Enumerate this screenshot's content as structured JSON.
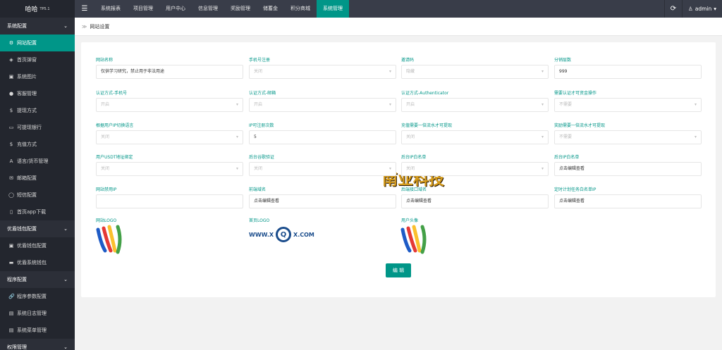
{
  "topbar": {
    "brand": "哈哈",
    "brand_sup": "TP5.1",
    "menu_icon": "☰",
    "nav": [
      "系统报表",
      "项目管理",
      "用户中心",
      "信息管理",
      "奖励管理",
      "储蓄金",
      "积分商城",
      "系统管理"
    ],
    "active_index": 7,
    "user": "admin",
    "user_caret": "▾"
  },
  "sidebar": {
    "groups": [
      {
        "label": "系统配置",
        "items": [
          {
            "icon": "⚙",
            "label": "网站配置",
            "active": true
          },
          {
            "icon": "◈",
            "label": "首页弹窗"
          },
          {
            "icon": "▣",
            "label": "系统图片"
          },
          {
            "icon": "●",
            "label": "客服管理"
          },
          {
            "icon": "$",
            "label": "提现方式"
          },
          {
            "icon": "▭",
            "label": "可提现银行"
          },
          {
            "icon": "$",
            "label": "充值方式"
          },
          {
            "icon": "A",
            "label": "语言/货币管理"
          },
          {
            "icon": "✉",
            "label": "邮箱配置"
          },
          {
            "icon": "◯",
            "label": "短信配置"
          },
          {
            "icon": "▯",
            "label": "首页app下载"
          }
        ]
      },
      {
        "label": "优盾钱包配置",
        "items": [
          {
            "icon": "▣",
            "label": "优盾钱包配置"
          },
          {
            "icon": "▬",
            "label": "优盾系统钱包"
          }
        ]
      },
      {
        "label": "程序配置",
        "items": [
          {
            "icon": "🔗",
            "label": "程序参数配置"
          },
          {
            "icon": "▤",
            "label": "系统日志管理"
          },
          {
            "icon": "▤",
            "label": "系统菜单管理"
          }
        ]
      },
      {
        "label": "权限管理",
        "items": []
      }
    ]
  },
  "breadcrumb": {
    "sep": "≫",
    "label": "网站设置"
  },
  "form": {
    "rows": [
      [
        {
          "label": "网站名称",
          "value": "仅供学习研究，禁止用于非法用途",
          "type": "text"
        },
        {
          "label": "手机号注册",
          "value": "关闭",
          "type": "select"
        },
        {
          "label": "邀请码",
          "value": "隐藏",
          "type": "select"
        },
        {
          "label": "分销层数",
          "value": "999",
          "type": "text"
        }
      ],
      [
        {
          "label": "认证方式-手机号",
          "value": "开启",
          "type": "select"
        },
        {
          "label": "认证方式-邮箱",
          "value": "开启",
          "type": "select"
        },
        {
          "label": "认证方式-Authenticator",
          "value": "开启",
          "type": "select"
        },
        {
          "label": "需要认证才可资金操作",
          "value": "不需要",
          "type": "select"
        }
      ],
      [
        {
          "label": "根据用户IP切换语言",
          "value": "关闭",
          "type": "select"
        },
        {
          "label": "IP可注册次数",
          "value": "5",
          "type": "text"
        },
        {
          "label": "充值需要一倍流水才可提现",
          "value": "关闭",
          "type": "select"
        },
        {
          "label": "奖励需要一倍流水才可提现",
          "value": "不需要",
          "type": "select"
        }
      ],
      [
        {
          "label": "用户USDT地址绑定",
          "value": "关闭",
          "type": "select"
        },
        {
          "label": "后台谷歌验证",
          "value": "关闭",
          "type": "select"
        },
        {
          "label": "后台IP白名单",
          "value": "关闭",
          "type": "select"
        },
        {
          "label": "后台IP白名单",
          "value": "点击编辑查看",
          "type": "text"
        }
      ],
      [
        {
          "label": "网站禁用IP",
          "value": "",
          "type": "text"
        },
        {
          "label": "前端域名",
          "value": "点击编辑查看",
          "type": "text"
        },
        {
          "label": "后端接口域名",
          "value": "点击编辑查看",
          "type": "text"
        },
        {
          "label": "定时计划任务白名单IP",
          "value": "点击编辑查看",
          "type": "text"
        }
      ]
    ],
    "logos": {
      "site_logo_label": "网站LOGO",
      "home_logo_label": "首页LOGO",
      "avatar_label": "用户头像",
      "home_logo_text_left": "WWW.X",
      "home_logo_text_mid": "Q",
      "home_logo_text_x": "X",
      "home_logo_text_right": "X.COM"
    },
    "submit_label": "编 辑"
  },
  "watermark": {
    "text": "南业科技",
    "colors": {
      "gold": "#d49a1a",
      "dark": "#2a1a08"
    }
  },
  "colors": {
    "accent": "#009688",
    "topbar": "#393d49",
    "sidebar": "#23262e"
  }
}
